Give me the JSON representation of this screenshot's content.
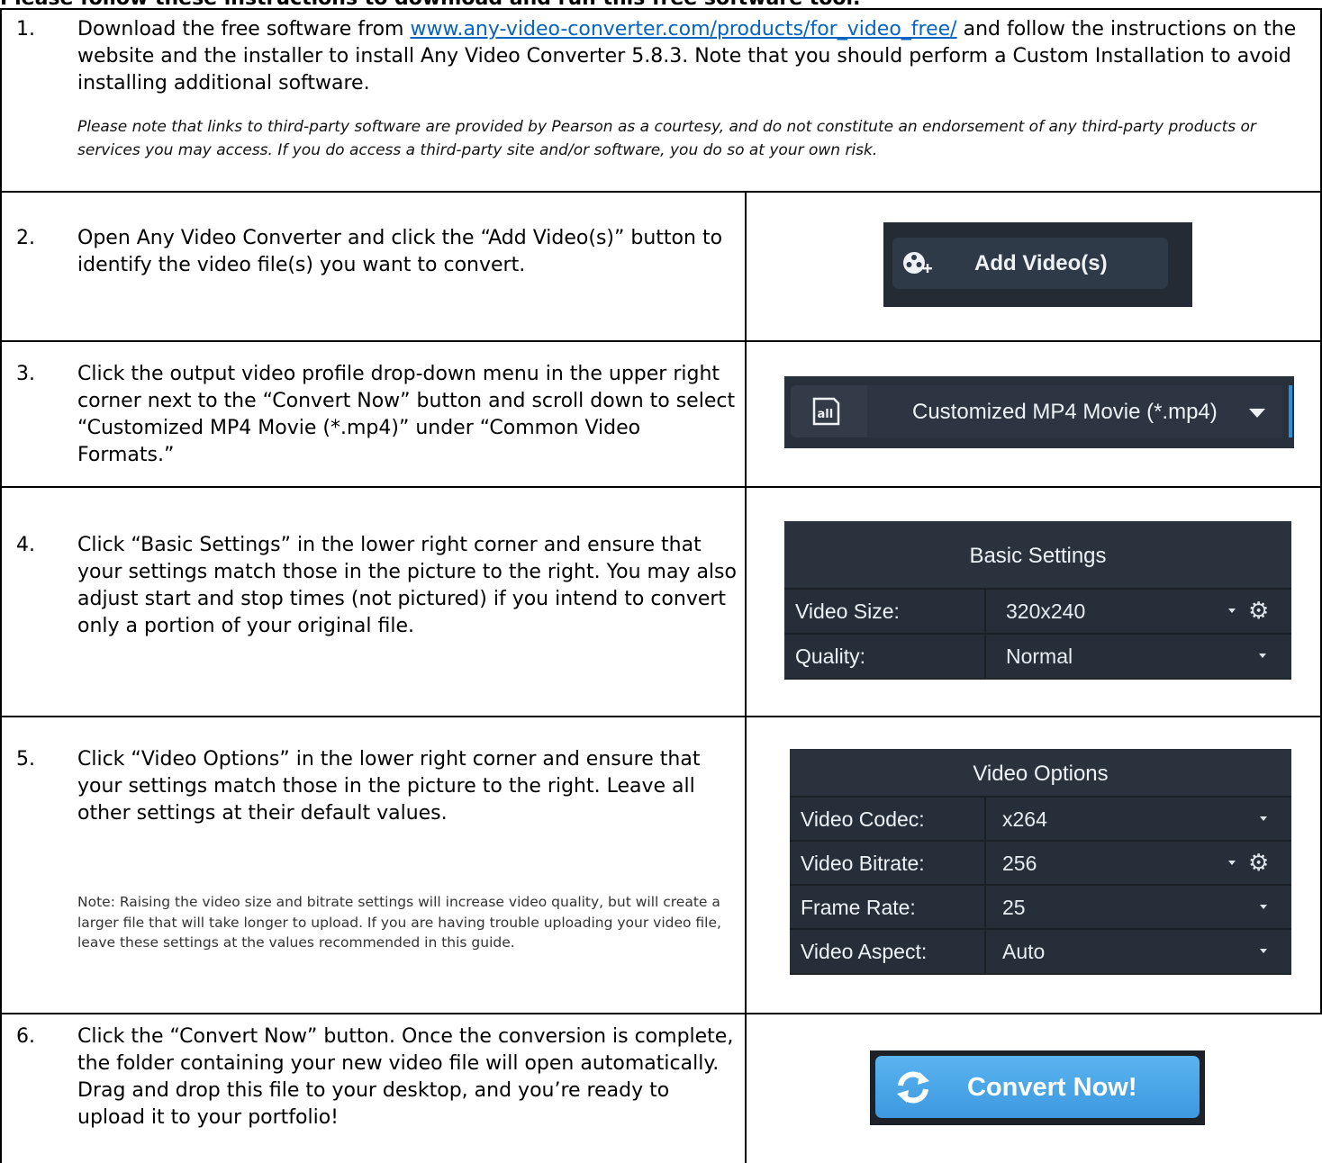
{
  "heading": "Please follow these instructions to download and run this free software tool.",
  "steps": [
    {
      "number": "1.",
      "text_before_link": "Download the free software from ",
      "link": "www.any-video-converter.com/products/for_video_free/",
      "text_after_link": " and follow the instructions on the website and the installer to install Any Video Converter 5.8.3. Note that you should perform a Custom Installation to avoid installing additional software.",
      "note": "Please note that links to third-party software are provided by Pearson as a courtesy, and do not constitute an endorsement of any third-party products or services you may access. If you do access a third-party site and/or software, you do so at your own risk."
    },
    {
      "number": "2.",
      "text": "Open Any Video Converter and click the “Add Video(s)” button to identify the video file(s) you want to convert."
    },
    {
      "number": "3.",
      "text": "Click the output video profile drop-down menu in the upper right corner next to the “Convert Now” button and scroll down to select “Customized MP4 Movie (*.mp4)” under “Common Video Formats.”"
    },
    {
      "number": "4.",
      "text": "Click “Basic Settings” in the lower right corner and ensure that your settings match those in the picture to the right. You may also adjust start and stop times (not pictured) if you intend to convert only a portion of your original file."
    },
    {
      "number": "5.",
      "text": "Click “Video Options” in the lower right corner and ensure that your settings match those in the picture to the right. Leave all other settings at their default values.",
      "note": "Note: Raising the video size and bitrate settings will increase video quality, but will create a larger file that will take longer to upload. If you are having trouble uploading your video file, leave these settings at the values recommended in this guide."
    },
    {
      "number": "6.",
      "text": "Click the “Convert Now” button. Once the conversion is complete, the folder containing your new video file will open automatically. Drag and drop this file to your desktop, and you’re ready to upload it to your portfolio!"
    }
  ],
  "ui": {
    "add_video": {
      "label": "Add Video(s)",
      "icon": "film-reel-plus-icon"
    },
    "profile": {
      "label": "Customized MP4 Movie (*.mp4)",
      "icon": "all-formats-icon"
    },
    "basic_settings": {
      "title": "Basic Settings",
      "rows": [
        {
          "key": "Video Size:",
          "value": "320x240"
        },
        {
          "key": "Quality:",
          "value": "Normal"
        }
      ]
    },
    "video_options": {
      "title": "Video Options",
      "rows": [
        {
          "key": "Video Codec:",
          "value": "x264"
        },
        {
          "key": "Video Bitrate:",
          "value": "256"
        },
        {
          "key": "Frame Rate:",
          "value": "25"
        },
        {
          "key": "Video Aspect:",
          "value": "Auto"
        }
      ]
    },
    "convert_now": {
      "label": "Convert Now!",
      "icon": "refresh-arrows-icon"
    }
  },
  "colors": {
    "link": "#0563c1",
    "ui_dark": "#252b34",
    "convert_blue": "#4aa6e8"
  }
}
